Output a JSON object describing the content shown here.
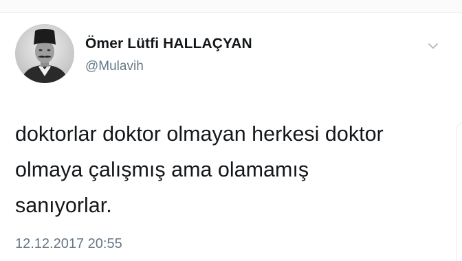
{
  "tweet": {
    "display_name": "Ömer Lütfi HALLAÇYAN",
    "handle": "@Mulavih",
    "text_lines": [
      "doktorlar doktor olmayan herkesi doktor",
      "olmaya çalışmış ama olamamış",
      "sanıyorlar."
    ],
    "timestamp": "12.12.2017 20:55",
    "avatar_icon": "profile-photo",
    "menu_icon": "chevron-down-icon"
  },
  "colors": {
    "primary_text": "#14171a",
    "secondary_text": "#657786",
    "divider": "#e6ecf0",
    "background": "#ffffff"
  }
}
